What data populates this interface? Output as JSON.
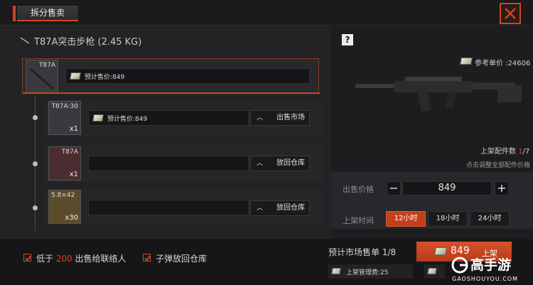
{
  "header": {
    "title": "拆分售卖"
  },
  "item": {
    "name": "T87A突击步枪 (2.45 KG)"
  },
  "main_row": {
    "thumb_name": "T87A",
    "price_text": "预计售价:849"
  },
  "sub_rows": [
    {
      "thumb_name": "T87A:30",
      "count": "x1",
      "price_text": "预计售价:849",
      "action": "出售市场"
    },
    {
      "thumb_name": "T87A",
      "count": "x1",
      "price_text": "",
      "action": "放回仓库"
    },
    {
      "thumb_name": "5.8×42",
      "count": "x30",
      "price_text": "",
      "action": "放回仓库"
    }
  ],
  "right_panel": {
    "help": "?",
    "ref_price": "参考单价 :24606",
    "parts_label": "上架配件数 ",
    "parts_current": "1",
    "parts_total": "/7",
    "adjust_all": "点击调整全部配件价格"
  },
  "sell": {
    "price_label": "出售价格",
    "minus": "−",
    "plus": "+",
    "price": "849",
    "time_label": "上架时间",
    "times": [
      "12小时",
      "18小时",
      "24小时"
    ],
    "selected_time": 0
  },
  "bottom": {
    "opt1_prefix": "低于 ",
    "opt1_num": "200",
    "opt1_suffix": " 出售给联络人",
    "opt2": "子弹放回仓库",
    "market_orders": "预计市场售单 1/8",
    "list_amount": "849",
    "list_label": "上架",
    "fee": "上架管理费:25"
  },
  "watermark": {
    "brand": "高手游",
    "url": "GAOSHOUYOU.COM"
  },
  "colors": {
    "accent": "#d2451f"
  }
}
